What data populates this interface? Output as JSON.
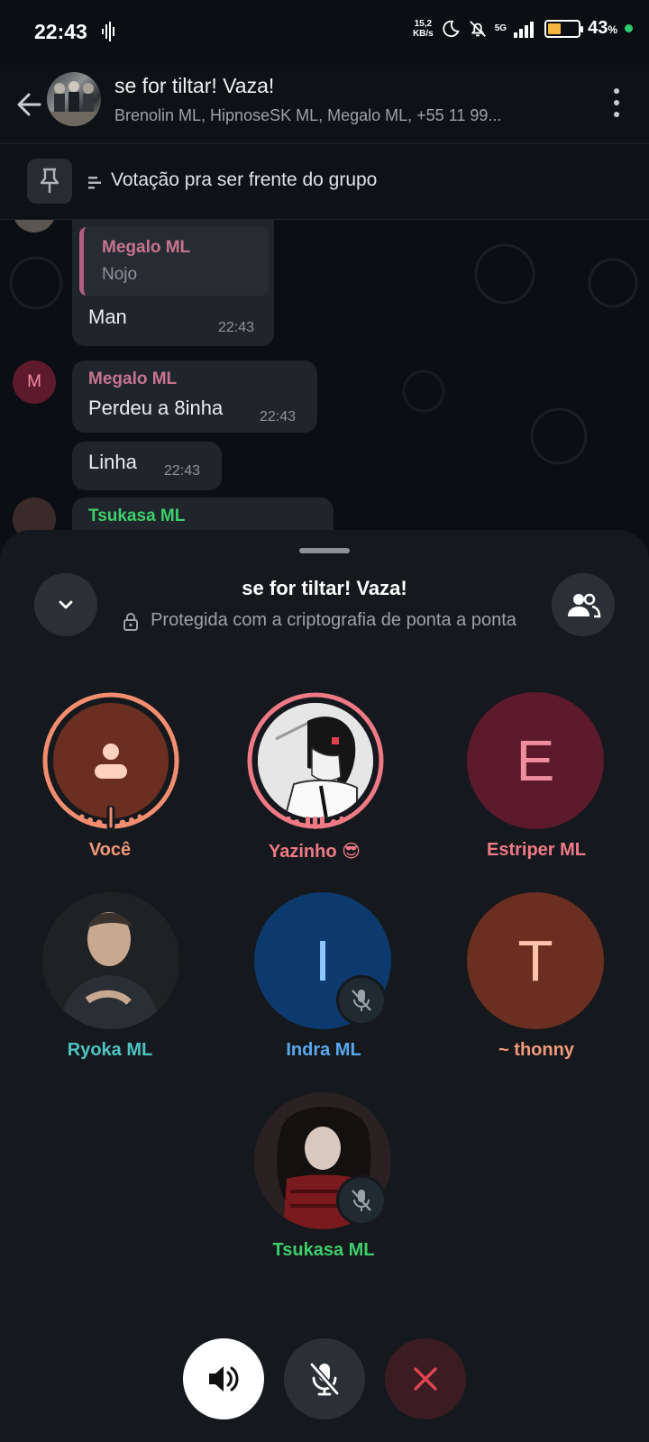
{
  "status_bar": {
    "time": "22:43",
    "speed_value": "15,2",
    "speed_unit": "KB/s",
    "network": "5G",
    "battery_percent": "43",
    "battery_symbol": "%"
  },
  "header": {
    "title": "se for tiltar! Vaza!",
    "subtitle": "Brenolin ML, HipnoseSK ML, Megalo ML, +55 11 99..."
  },
  "pinned": {
    "text": "Votação pra ser frente do grupo"
  },
  "chat": {
    "messages": [
      {
        "reply_name": "Megalo ML",
        "reply_text": "Nojo",
        "text": "Man",
        "time": "22:43"
      },
      {
        "avatar_letter": "M",
        "name": "Megalo ML",
        "text": "Perdeu a 8inha",
        "time": "22:43"
      },
      {
        "text": "Linha",
        "time": "22:43"
      },
      {
        "name": "Tsukasa ML"
      }
    ]
  },
  "call": {
    "title": "se for tiltar! Vaza!",
    "subtitle": "Protegida com a criptografia de ponta a ponta",
    "participants": [
      {
        "name": "Você",
        "name_color": "#f29a7a",
        "speaking": true
      },
      {
        "name": "Yazinho 😎",
        "name_color": "#ef7a86",
        "speaking": true
      },
      {
        "name": "Estriper ML",
        "letter": "E",
        "name_color": "#ef7a86",
        "bg": "#5e1a2d",
        "letter_color": "#f08ea0"
      },
      {
        "name": "Ryoka ML",
        "name_color": "#4fc3c1"
      },
      {
        "name": "Indra ML",
        "letter": "I",
        "name_color": "#5aa8f0",
        "bg": "#0d3a6e",
        "letter_color": "#8fc6ff",
        "muted": true
      },
      {
        "name": "~ thonny",
        "letter": "T",
        "name_color": "#f29a7a",
        "bg": "#6b2f22",
        "letter_color": "#ffc4ab"
      },
      {
        "name": "Tsukasa ML",
        "name_color": "#3ecf6a",
        "muted": true
      }
    ]
  },
  "icons": {
    "back": "arrow-left-icon",
    "menu": "kebab-icon",
    "pin": "pin-icon",
    "collapse": "chevron-down-icon",
    "participants": "people-icon",
    "speaker": "speaker-icon",
    "mic": "mic-off-icon",
    "end": "close-icon"
  },
  "colors": {
    "accent_red": "#e0454f",
    "end_call_bg": "#3a1c22"
  }
}
